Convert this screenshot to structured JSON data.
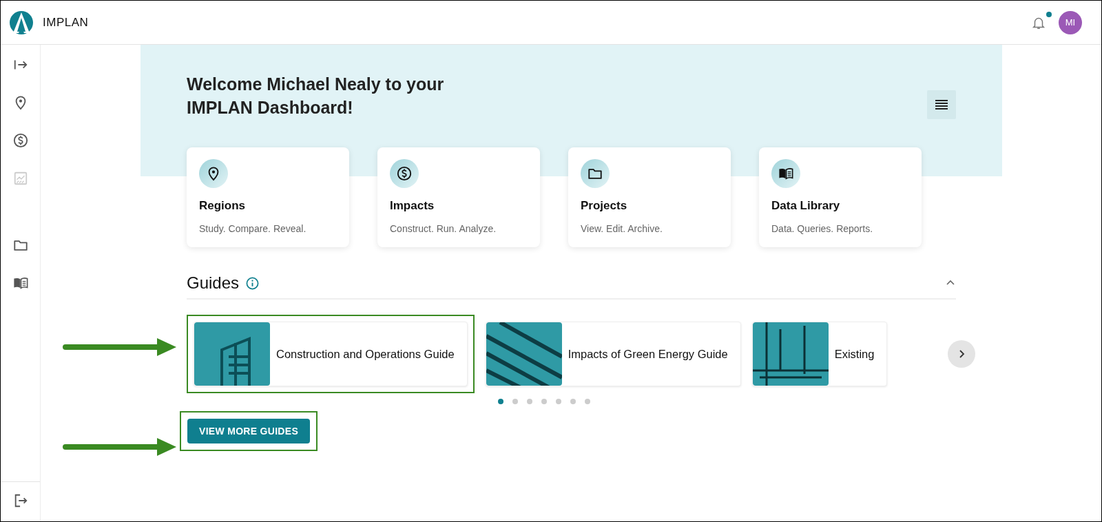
{
  "header": {
    "brand": "IMPLAN",
    "notification_unread": true,
    "avatar_initials": "MI"
  },
  "sidebar": {
    "items": [
      {
        "kind": "expand",
        "disabled": false
      },
      {
        "kind": "pin",
        "disabled": false
      },
      {
        "kind": "dollar",
        "disabled": false
      },
      {
        "kind": "chart",
        "disabled": true
      },
      {
        "kind": "folder",
        "disabled": false
      },
      {
        "kind": "book",
        "disabled": false
      }
    ],
    "footer_item": {
      "kind": "logout",
      "disabled": false
    }
  },
  "welcome": {
    "title": "Welcome Michael Nealy to your IMPLAN Dashboard!"
  },
  "cards": [
    {
      "kind": "pin",
      "title": "Regions",
      "subtitle": "Study. Compare. Reveal."
    },
    {
      "kind": "dollar",
      "title": "Impacts",
      "subtitle": "Construct. Run. Analyze."
    },
    {
      "kind": "folder",
      "title": "Projects",
      "subtitle": "View. Edit. Archive."
    },
    {
      "kind": "book",
      "title": "Data Library",
      "subtitle": "Data. Queries. Reports."
    }
  ],
  "guides": {
    "title": "Guides",
    "expanded": true,
    "items": [
      {
        "kind": "building",
        "title": "Construction and Operations Guide",
        "highlighted": true
      },
      {
        "kind": "solar",
        "title": "Impacts of Green Energy Guide",
        "highlighted": false
      },
      {
        "kind": "office",
        "title": "Existing",
        "highlighted": false
      }
    ],
    "pages": [
      {
        "selected": true
      },
      {
        "selected": false
      },
      {
        "selected": false
      },
      {
        "selected": false
      },
      {
        "selected": false
      },
      {
        "selected": false
      },
      {
        "selected": false
      }
    ],
    "button": {
      "label": "VIEW MORE GUIDES",
      "highlighted": true
    }
  }
}
